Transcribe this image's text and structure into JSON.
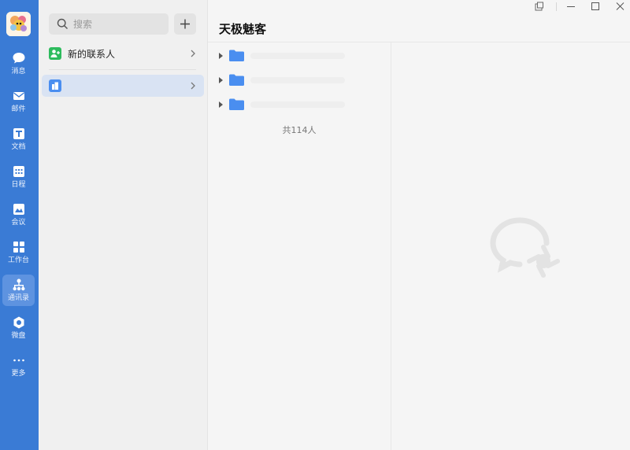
{
  "sidebar": {
    "items": [
      {
        "label": "消息",
        "icon": "chat-bubble-icon"
      },
      {
        "label": "邮件",
        "icon": "mail-icon"
      },
      {
        "label": "文档",
        "icon": "document-icon"
      },
      {
        "label": "日程",
        "icon": "calendar-icon"
      },
      {
        "label": "会议",
        "icon": "meeting-icon"
      },
      {
        "label": "工作台",
        "icon": "workbench-icon"
      },
      {
        "label": "通讯录",
        "icon": "contacts-icon",
        "active": true
      },
      {
        "label": "微盘",
        "icon": "cloud-disk-icon"
      },
      {
        "label": "更多",
        "icon": "more-icon"
      }
    ]
  },
  "contacts": {
    "search_placeholder": "搜索",
    "new_contacts_label": "新的联系人",
    "org_label": ""
  },
  "main": {
    "title": "天极魅客",
    "departments": [
      {
        "name": ""
      },
      {
        "name": ""
      },
      {
        "name": ""
      }
    ],
    "member_count": "共114人"
  },
  "colors": {
    "rail": "#3a7bd5",
    "accent": "#4a8ef0",
    "green": "#2dbb5d"
  }
}
